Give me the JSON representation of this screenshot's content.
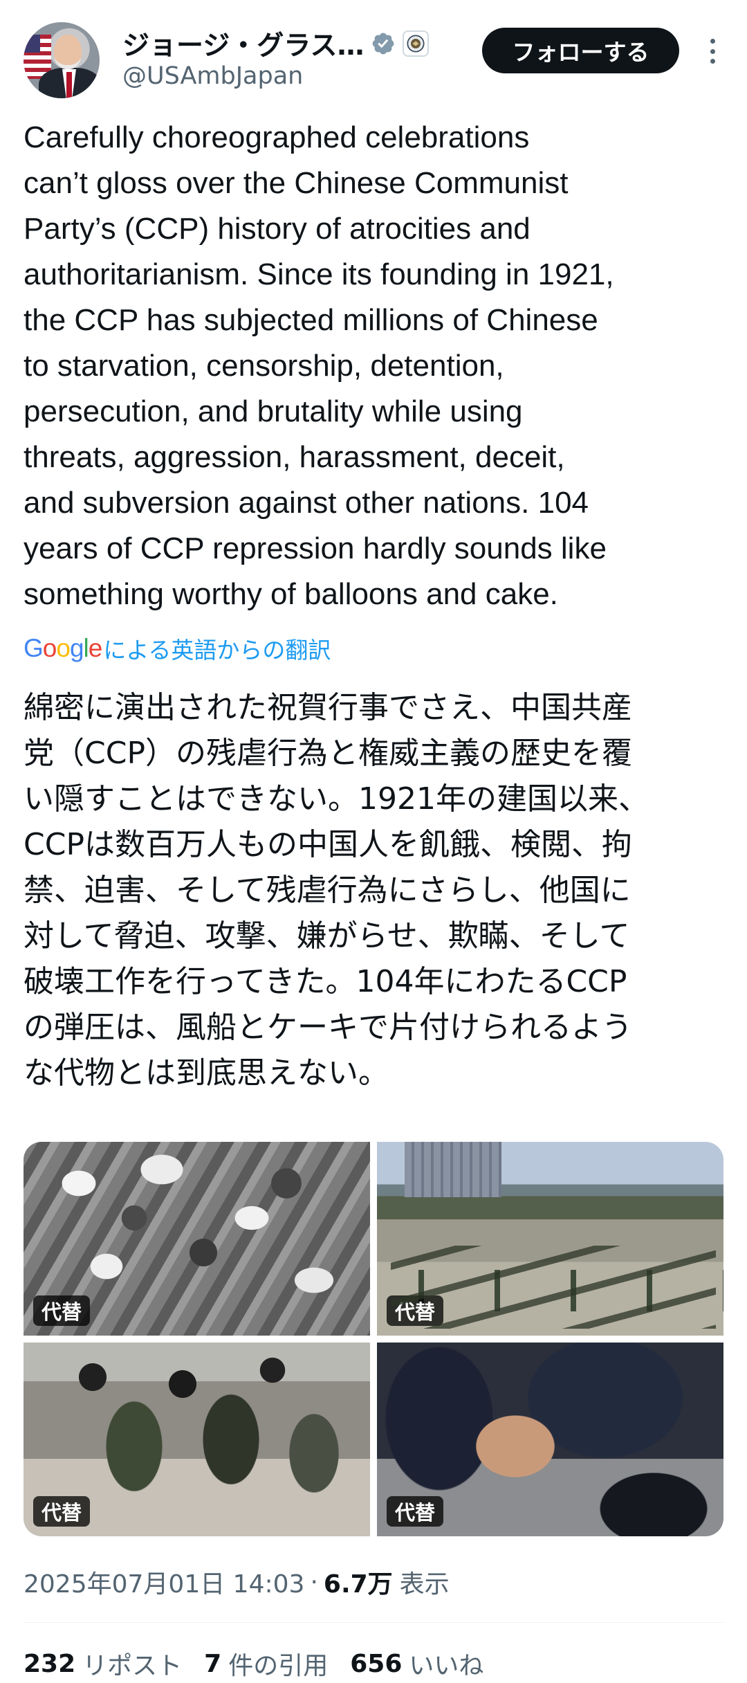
{
  "author": {
    "display_name": "ジョージ・グラス…",
    "handle": "@USAmbJapan",
    "verified_color": "#829aab"
  },
  "follow_button_label": "フォローする",
  "tweet": {
    "lines": [
      "Carefully choreographed celebrations",
      "can’t gloss over the Chinese Communist",
      "Party’s (CCP) history of atrocities and",
      "authoritarianism. Since its founding in 1921,",
      "the CCP has subjected millions of Chinese",
      "to starvation, censorship, detention,",
      "persecution, and brutality while using",
      "threats, aggression, harassment, deceit,",
      "and subversion against other nations. 104",
      "years of CCP repression hardly sounds like",
      "something worthy of balloons and cake."
    ]
  },
  "translation": {
    "google_label": "Google",
    "label": "による英語からの翻訳",
    "lines": [
      "綿密に演出された祝賀行事でさえ、中国共産",
      "党（CCP）の残虐行為と権威主義の歴史を覆",
      "い隠すことはできない。1921年の建国以来、",
      "CCPは数百万人もの中国人を飢餓、検閲、拘",
      "禁、迫害、そして残虐行為にさらし、他国に",
      "対して脅迫、攻撃、嫌がらせ、欺瞞、そして",
      "破壊工作を行ってきた。104年にわたるCCP",
      "の弾圧は、風船とケーキで片付けられるよう",
      "な代物とは到底思えない。"
    ]
  },
  "media": {
    "alt_label": "代替",
    "count": 4
  },
  "meta": {
    "timestamp": "2025年07月01日 14:03",
    "separator": "·",
    "views_count": "6.7万",
    "views_label": "表示"
  },
  "stats": {
    "reposts_count": "232",
    "reposts_label": "リポスト",
    "quotes_count": "7",
    "quotes_label": "件の引用",
    "likes_count": "656",
    "likes_label": "いいね"
  },
  "colors": {
    "text": "#0f1419",
    "secondary_text": "#536471",
    "link": "#1d9bf0"
  }
}
